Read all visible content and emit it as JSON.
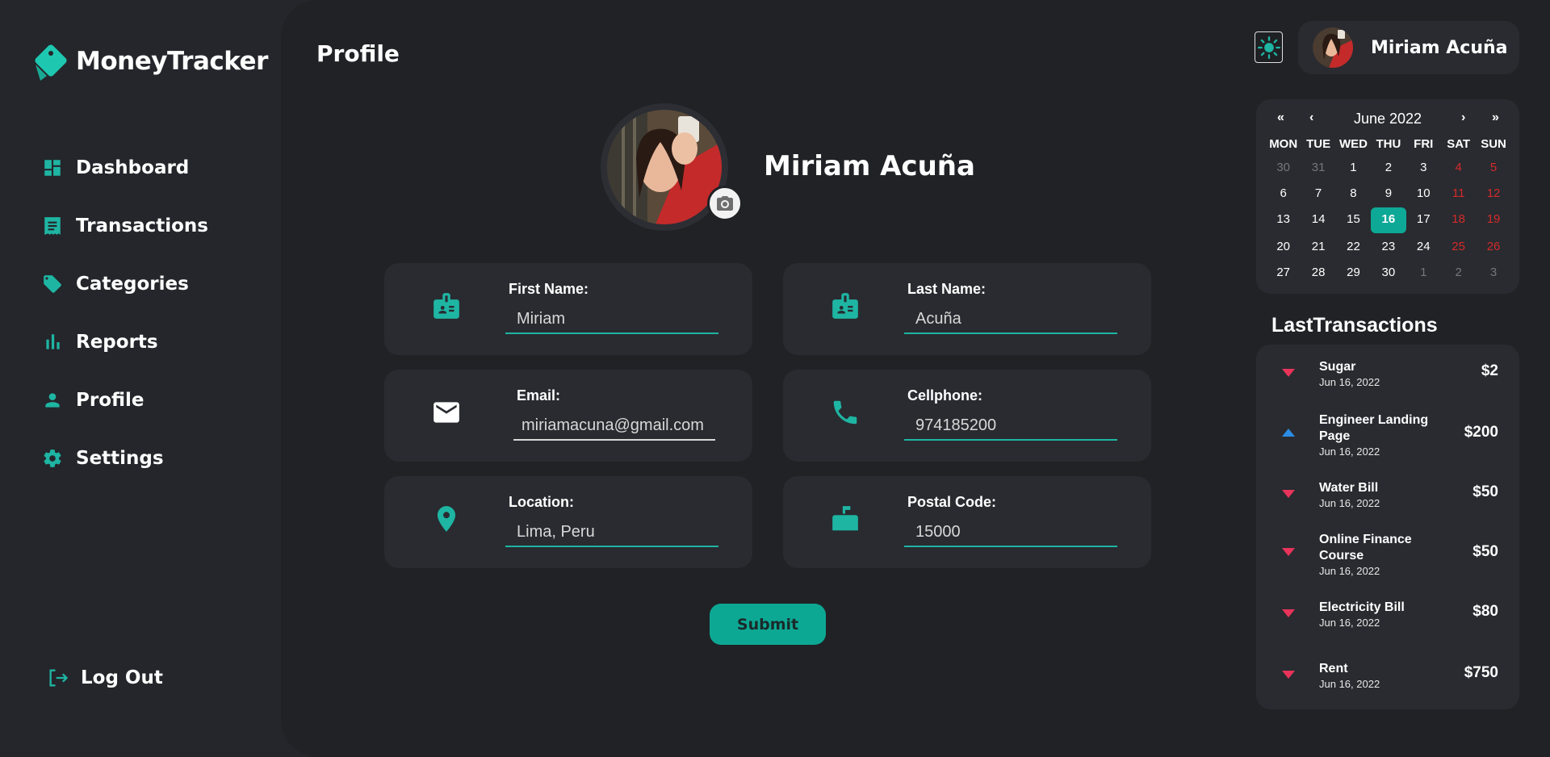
{
  "app": {
    "name": "MoneyTracker"
  },
  "sidebar": {
    "items": [
      {
        "label": "Dashboard",
        "icon": "dashboard-icon"
      },
      {
        "label": "Transactions",
        "icon": "receipt-icon"
      },
      {
        "label": "Categories",
        "icon": "tag-icon"
      },
      {
        "label": "Reports",
        "icon": "bar-chart-icon"
      },
      {
        "label": "Profile",
        "icon": "person-icon"
      },
      {
        "label": "Settings",
        "icon": "gear-icon"
      }
    ],
    "logout_label": "Log Out"
  },
  "page": {
    "title": "Profile"
  },
  "profile": {
    "name": "Miriam Acuña",
    "fields": {
      "first_name": {
        "label": "First Name:",
        "value": "Miriam"
      },
      "last_name": {
        "label": "Last Name:",
        "value": "Acuña"
      },
      "email": {
        "label": "Email:",
        "value": "miriamacuna@gmail.com"
      },
      "cellphone": {
        "label": "Cellphone:",
        "value": "974185200"
      },
      "location": {
        "label": "Location:",
        "value": "Lima, Peru"
      },
      "postal_code": {
        "label": "Postal Code:",
        "value": "15000"
      }
    },
    "submit_label": "Submit"
  },
  "header": {
    "user_name": "Miriam Acuña"
  },
  "calendar": {
    "nav": {
      "prev_year": "«",
      "prev_month": "‹",
      "next_month": "›",
      "next_year": "»"
    },
    "title": "June 2022",
    "weekdays": [
      "MON",
      "TUE",
      "WED",
      "THU",
      "FRI",
      "SAT",
      "SUN"
    ],
    "weeks": [
      [
        "30",
        "31",
        "1",
        "2",
        "3",
        "4",
        "5"
      ],
      [
        "6",
        "7",
        "8",
        "9",
        "10",
        "11",
        "12"
      ],
      [
        "13",
        "14",
        "15",
        "16",
        "17",
        "18",
        "19"
      ],
      [
        "20",
        "21",
        "22",
        "23",
        "24",
        "25",
        "26"
      ],
      [
        "27",
        "28",
        "29",
        "30",
        "1",
        "2",
        "3"
      ]
    ],
    "today": "16"
  },
  "transactions": {
    "title": "LastTransactions",
    "items": [
      {
        "name": "Sugar",
        "date": "Jun 16, 2022",
        "amount": "$2",
        "direction": "down"
      },
      {
        "name": "Engineer Landing Page",
        "date": "Jun 16, 2022",
        "amount": "$200",
        "direction": "up"
      },
      {
        "name": "Water Bill",
        "date": "Jun 16, 2022",
        "amount": "$50",
        "direction": "down"
      },
      {
        "name": "Online Finance Course",
        "date": "Jun 16, 2022",
        "amount": "$50",
        "direction": "down"
      },
      {
        "name": "Electricity Bill",
        "date": "Jun 16, 2022",
        "amount": "$80",
        "direction": "down"
      },
      {
        "name": "Rent",
        "date": "Jun 16, 2022",
        "amount": "$750",
        "direction": "down"
      }
    ]
  },
  "colors": {
    "accent": "#0da894",
    "background": "#24262b",
    "card": "#292b30",
    "expense": "#e8335a",
    "income": "#2b8de6",
    "weekend": "#d42a2a"
  }
}
